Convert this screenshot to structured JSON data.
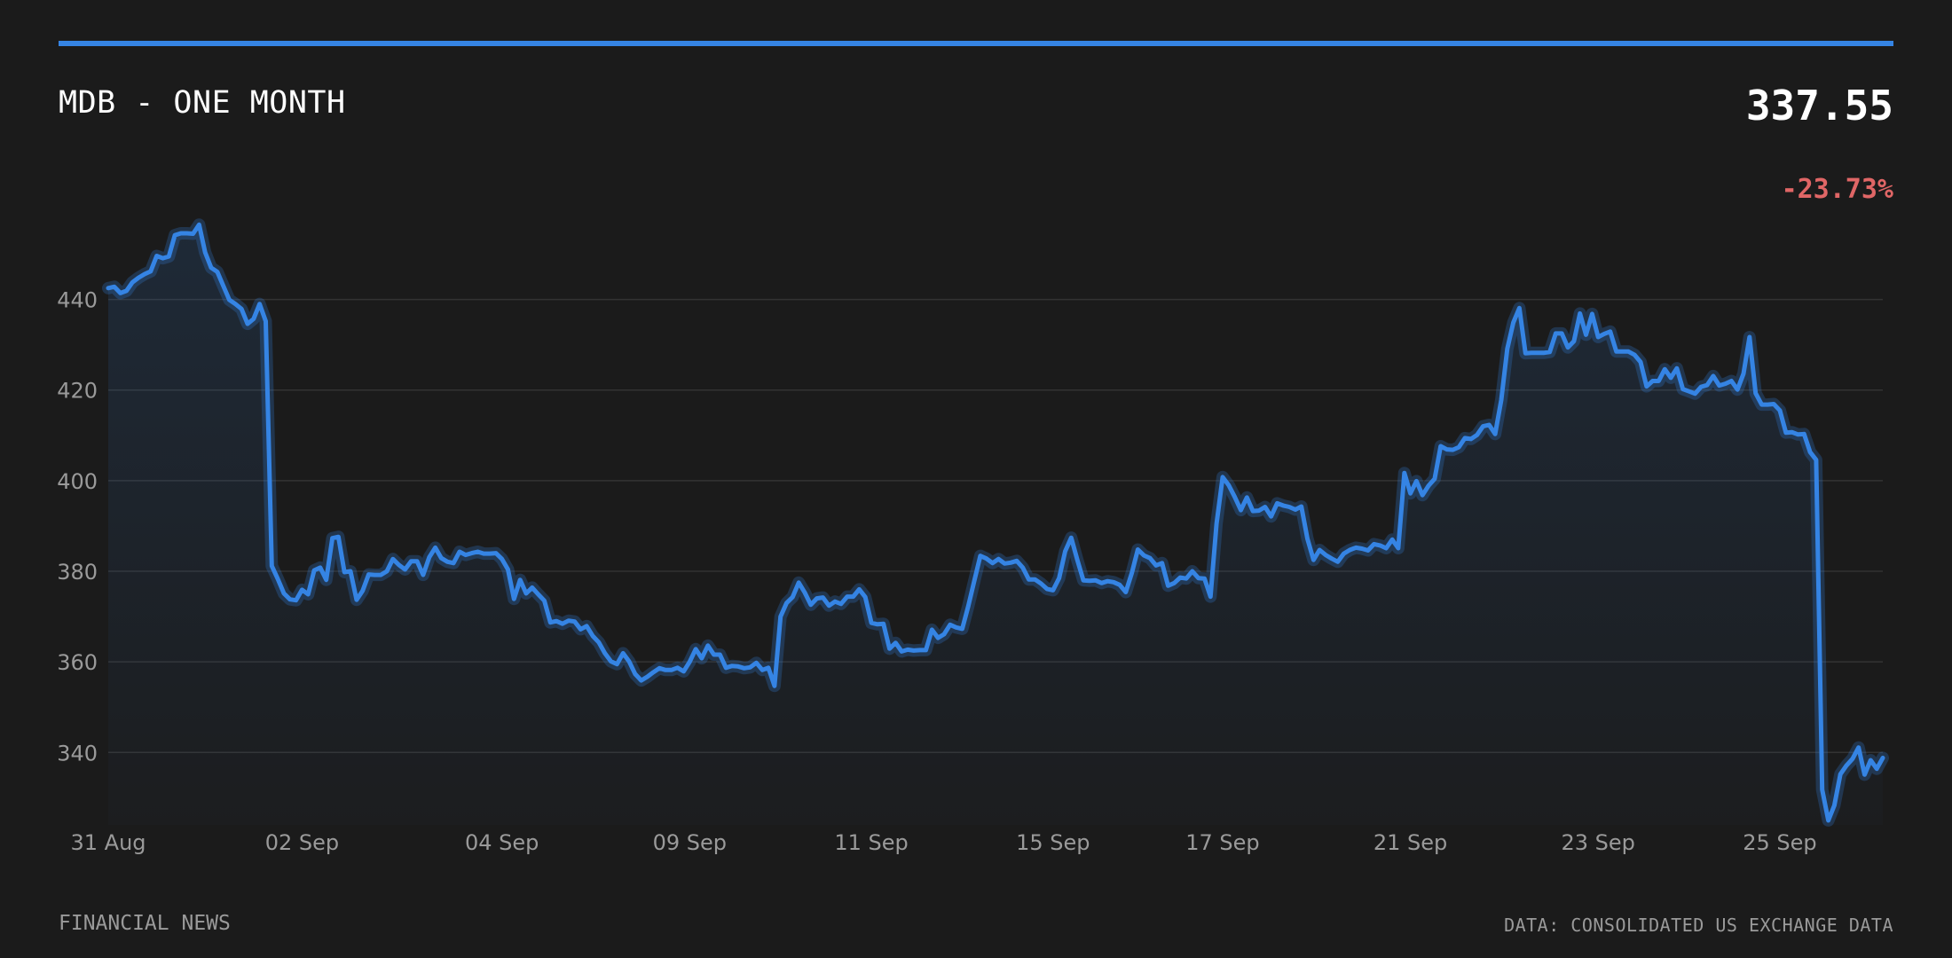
{
  "header": {
    "title": "MDB - ONE MONTH",
    "price": "337.55",
    "change": "-23.73%"
  },
  "footer": {
    "source_left": "FINANCIAL NEWS",
    "source_right": "DATA: CONSOLIDATED US EXCHANGE DATA"
  },
  "colors": {
    "background": "#1b1b1b",
    "accent": "#3584e4",
    "negative": "#e06666",
    "grid": "#333333",
    "tick_text": "#9a9a9a"
  },
  "chart_data": {
    "type": "line",
    "title": "MDB - ONE MONTH",
    "xlabel": "",
    "ylabel": "",
    "ylim": [
      324,
      464
    ],
    "yticks": [
      340,
      360,
      380,
      400,
      420,
      440
    ],
    "grid": true,
    "x_tick_labels": [
      "31 Aug",
      "02 Sep",
      "04 Sep",
      "09 Sep",
      "11 Sep",
      "15 Sep",
      "17 Sep",
      "21 Sep",
      "23 Sep",
      "25 Sep"
    ],
    "x_tick_indices": [
      0,
      32,
      65,
      96,
      126,
      156,
      184,
      215,
      246,
      276
    ],
    "series": [
      {
        "values": [
          442.5,
          442.8,
          441.4,
          441.9,
          443.8,
          444.8,
          445.6,
          446.2,
          449.6,
          449.1,
          449.5,
          454.2,
          454.6,
          454.6,
          454.5,
          456.5,
          450.4,
          447.0,
          446.1,
          443.0,
          439.9,
          439.0,
          437.9,
          434.6,
          435.7,
          439.0,
          435.2,
          381.2,
          378.3,
          375.1,
          373.8,
          373.6,
          375.9,
          374.9,
          380.2,
          380.8,
          378.1,
          387.3,
          387.6,
          379.8,
          380.0,
          373.7,
          375.7,
          379.3,
          379.2,
          379.2,
          380.0,
          382.7,
          381.4,
          380.4,
          382.2,
          382.2,
          379.2,
          383.1,
          385.2,
          382.9,
          382.1,
          381.8,
          384.3,
          383.6,
          384.0,
          384.3,
          383.9,
          383.9,
          384.0,
          382.7,
          380.4,
          373.9,
          378.1,
          375.1,
          376.4,
          374.9,
          373.5,
          368.7,
          369.0,
          368.4,
          369.1,
          368.9,
          367.2,
          367.9,
          365.7,
          364.3,
          361.9,
          360.1,
          359.5,
          361.9,
          360.1,
          357.3,
          355.9,
          356.7,
          357.7,
          358.6,
          358.2,
          358.2,
          358.7,
          357.9,
          360.0,
          362.8,
          360.8,
          363.6,
          361.6,
          361.6,
          358.7,
          359.1,
          359.0,
          358.6,
          358.8,
          359.8,
          358.2,
          358.7,
          354.7,
          370.0,
          373.0,
          374.3,
          377.5,
          375.3,
          372.6,
          374.0,
          374.2,
          372.4,
          373.3,
          372.8,
          374.4,
          374.4,
          376.0,
          374.3,
          368.6,
          368.3,
          368.4,
          362.9,
          364.2,
          362.3,
          362.7,
          362.5,
          362.6,
          362.6,
          367.1,
          365.3,
          366.1,
          368.2,
          367.6,
          367.3,
          372.3,
          377.9,
          383.4,
          382.8,
          381.8,
          382.7,
          381.7,
          381.9,
          382.3,
          380.8,
          378.2,
          378.2,
          377.3,
          376.1,
          375.8,
          378.5,
          384.4,
          387.4,
          382.5,
          378.0,
          377.9,
          378.0,
          377.4,
          377.8,
          377.6,
          377.0,
          375.4,
          379.6,
          384.8,
          383.5,
          382.9,
          381.3,
          381.8,
          376.8,
          377.4,
          378.6,
          378.4,
          380.0,
          378.5,
          378.4,
          374.4,
          390.5,
          400.8,
          399.0,
          396.4,
          393.5,
          396.3,
          393.3,
          393.4,
          394.2,
          392.1,
          395.0,
          394.5,
          394.2,
          393.6,
          394.3,
          387.2,
          382.5,
          384.7,
          383.6,
          382.8,
          382.1,
          383.9,
          384.7,
          385.2,
          385.0,
          384.6,
          386.0,
          385.7,
          385.1,
          387.0,
          385.1,
          401.7,
          397.2,
          399.9,
          396.8,
          398.9,
          400.4,
          407.6,
          406.9,
          406.8,
          407.4,
          409.4,
          409.2,
          410.1,
          412.0,
          412.3,
          410.3,
          417.8,
          429.1,
          434.9,
          438.1,
          428.1,
          428.2,
          428.2,
          428.2,
          428.4,
          432.5,
          432.5,
          429.4,
          430.8,
          436.9,
          432.2,
          436.8,
          431.7,
          432.4,
          432.9,
          428.5,
          428.5,
          428.5,
          427.8,
          426.2,
          420.8,
          422.0,
          422.0,
          424.6,
          422.7,
          424.8,
          420.2,
          419.7,
          419.2,
          420.7,
          421.1,
          423.1,
          421.0,
          421.4,
          422.0,
          420.1,
          423.6,
          431.7,
          419.3,
          416.8,
          416.8,
          416.9,
          415.5,
          410.6,
          410.7,
          410.2,
          410.3,
          406.3,
          404.6,
          331.8,
          325.0,
          328.3,
          335.2,
          337.1,
          338.6,
          341.1,
          335.1,
          338.3,
          336.4,
          338.8
        ]
      }
    ]
  }
}
